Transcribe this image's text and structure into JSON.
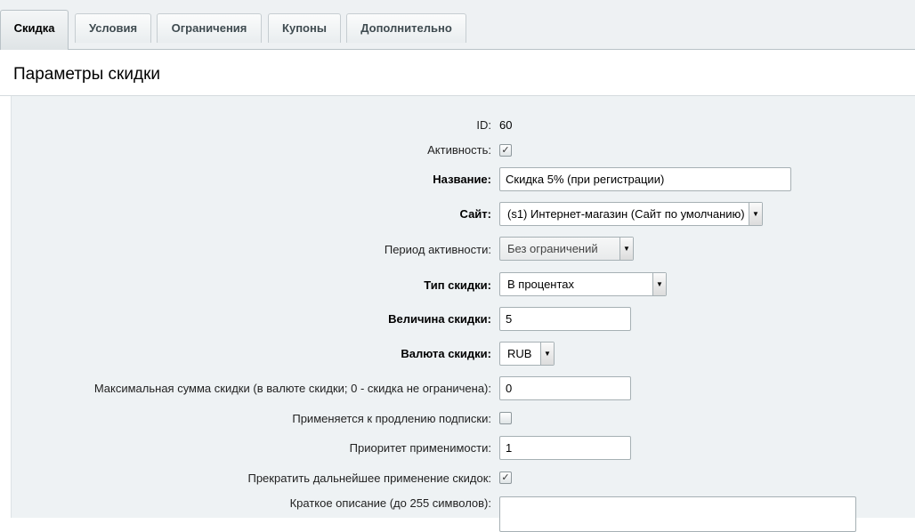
{
  "tabs": [
    {
      "label": "Скидка",
      "active": true
    },
    {
      "label": "Условия",
      "active": false
    },
    {
      "label": "Ограничения",
      "active": false
    },
    {
      "label": "Купоны",
      "active": false
    },
    {
      "label": "Дополнительно",
      "active": false
    }
  ],
  "section_title": "Параметры скидки",
  "form": {
    "id": {
      "label": "ID:",
      "value": "60"
    },
    "active": {
      "label": "Активность:",
      "checked": true
    },
    "name": {
      "label": "Название:",
      "value": "Скидка 5%  (при регистрации)"
    },
    "site": {
      "label": "Сайт:",
      "value": "(s1) Интернет-магазин (Сайт по умолчанию)"
    },
    "period": {
      "label": "Период активности:",
      "value": "Без ограничений"
    },
    "discount_type": {
      "label": "Тип скидки:",
      "value": "В процентах"
    },
    "discount_value": {
      "label": "Величина скидки:",
      "value": "5"
    },
    "currency": {
      "label": "Валюта скидки:",
      "value": "RUB"
    },
    "max_sum": {
      "label": "Максимальная сумма скидки (в валюте скидки; 0 - скидка не ограничена):",
      "value": "0"
    },
    "renewal": {
      "label": "Применяется к продлению подписки:",
      "checked": false
    },
    "priority": {
      "label": "Приоритет применимости:",
      "value": "1"
    },
    "stop_further": {
      "label": "Прекратить дальнейшее применение скидок:",
      "checked": true
    },
    "short_desc": {
      "label": "Краткое описание (до 255 символов):",
      "value": ""
    }
  },
  "icons": {
    "checkmark": "✓",
    "dropdown_arrow": "▼"
  }
}
